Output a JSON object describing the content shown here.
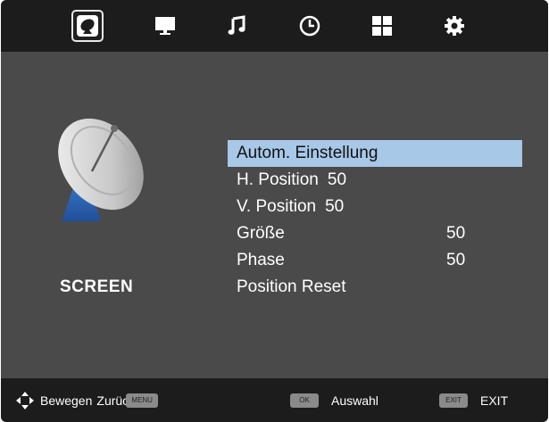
{
  "tabs": [
    {
      "name": "picture",
      "icon": "satellite-dish-icon",
      "active": true
    },
    {
      "name": "screen",
      "icon": "monitor-icon",
      "active": false
    },
    {
      "name": "audio",
      "icon": "music-note-icon",
      "active": false
    },
    {
      "name": "time",
      "icon": "clock-icon",
      "active": false
    },
    {
      "name": "setup",
      "icon": "grid-icon",
      "active": false
    },
    {
      "name": "settings",
      "icon": "gear-icon",
      "active": false
    }
  ],
  "section": {
    "title": "SCREEN",
    "icon": "satellite-dish-icon"
  },
  "menu": {
    "items": [
      {
        "label": "Autom. Einstellung",
        "value": ""
      },
      {
        "label": "H. Position",
        "value": "50"
      },
      {
        "label": "V. Position",
        "value": "50"
      },
      {
        "label": "Größe",
        "value": "50"
      },
      {
        "label": "Phase",
        "value": "50"
      },
      {
        "label": "Position Reset",
        "value": ""
      }
    ],
    "selected_index": 0
  },
  "footer": {
    "move_label": "Bewegen",
    "back_label": "Zurüc",
    "menu_key": "MENU",
    "ok_key": "OK",
    "select_label": "Auswahl",
    "exit_key": "EXIT",
    "exit_label": "EXIT"
  },
  "colors": {
    "background": "#4a4a4a",
    "bar": "#1c1c1c",
    "highlight": "#a8c8e8",
    "text": "#ffffff"
  }
}
